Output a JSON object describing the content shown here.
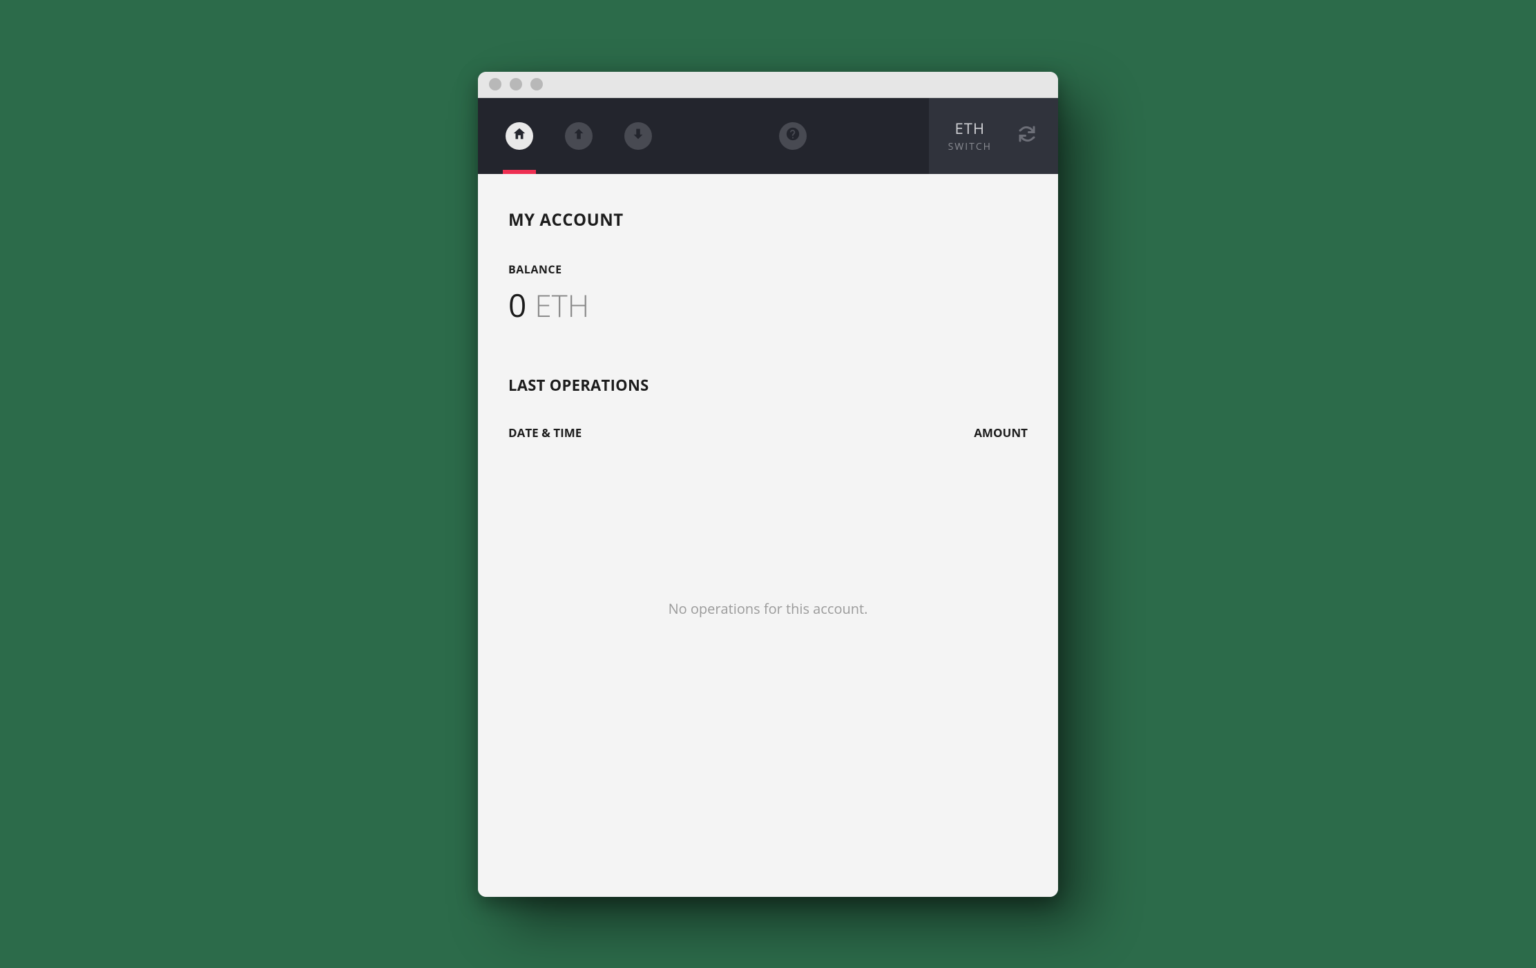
{
  "nav": {
    "currency": "ETH",
    "switch_label": "SWITCH"
  },
  "account": {
    "title": "MY ACCOUNT",
    "balance_label": "BALANCE",
    "balance_value": "0",
    "balance_unit": "ETH"
  },
  "operations": {
    "title": "LAST OPERATIONS",
    "col_date": "DATE & TIME",
    "col_amount": "AMOUNT",
    "empty_message": "No operations for this account."
  }
}
